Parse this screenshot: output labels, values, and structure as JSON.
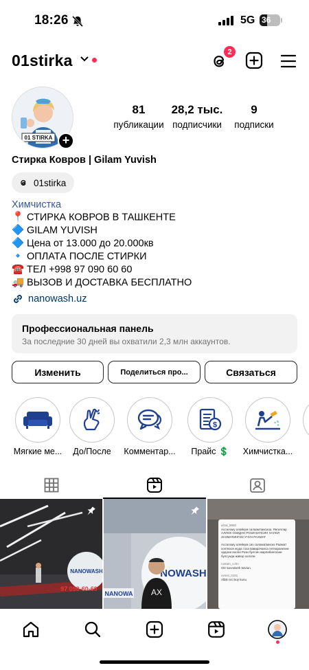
{
  "status_bar": {
    "time": "18:26",
    "network": "5G",
    "battery": "36",
    "battery_level": 0.36
  },
  "header": {
    "username": "01stirka",
    "notification_count": "2",
    "icons": [
      "threads-icon",
      "new-post-icon",
      "menu-icon"
    ]
  },
  "profile": {
    "stats": [
      {
        "value": "81",
        "label": "публикации"
      },
      {
        "value": "28,2 тыс.",
        "label": "подписчики"
      },
      {
        "value": "9",
        "label": "подписки"
      }
    ],
    "display_name": "Стирка Ковров | Gilam Yuvish",
    "threads_handle": "01stirka",
    "category": "Химчистка",
    "bio": [
      {
        "icon": "📍",
        "text": "СТИРКА КОВРОВ В ТАШКЕНТЕ"
      },
      {
        "icon": "🔷",
        "text": "GILAM YUVISH"
      },
      {
        "icon": "🔷",
        "text": "Цена от 13.000 до 20.000кв"
      },
      {
        "icon": "🔹",
        "text": "ОПЛАТА ПОСЛЕ СТИРКИ"
      },
      {
        "icon": "☎️",
        "text": "ТЕЛ +998 97 090 60 60"
      },
      {
        "icon": "🚚",
        "text": "ВЫЗОВ И ДОСТАВКА БЕСПЛАТНО"
      }
    ],
    "link": "nanowash.uz",
    "avatar_text": "01 STIRKA"
  },
  "pro_panel": {
    "title": "Профессиональная панель",
    "subtitle": "За последние 30 дней вы охватили 2,3 млн аккаунтов."
  },
  "actions": {
    "edit": "Изменить",
    "share": "Поделиться про...",
    "contact": "Связаться"
  },
  "highlights": [
    {
      "label": "Мягкие ме...",
      "icon": "sofa-icon"
    },
    {
      "label": "До/После",
      "icon": "fingers-crossed-icon"
    },
    {
      "label": "Комментар...",
      "icon": "comments-icon"
    },
    {
      "label": "Прайс 💲",
      "icon": "price-list-icon"
    },
    {
      "label": "Химчистка...",
      "icon": "carpet-cleaning-icon"
    }
  ],
  "tabs": [
    "grid-icon",
    "reels-icon",
    "tagged-icon"
  ],
  "posts": [
    {
      "text_logo": "NANOWASH",
      "text_phone": "97 090-60-60"
    },
    {
      "text_logo": "NOWASH",
      "text_sub": "NANOWA"
    },
    {
      "comments": [
        {
          "user": "afzal_9990",
          "text": "Ассалому алайкум салаамтмисиза. Янгиллар АЛЛОХ ОЗИДАН РОЗИ БУЛСИН ХАЛОЛ ЗАХМАТИНГИЗ УЧУН РАХМАТ"
        },
        {
          "user": "",
          "text": "Ассалому алейкум сиз саламатмисиз Раамат хоптвоон жуда тоза ваварачанса геппаранизни ордони аоопи Рози булсин жарпабингизни булсунда жавор холопи"
        },
        {
          "user": "rustam_cchn",
          "text": "Ok! 5ovrabeth 5aviun."
        },
        {
          "user": "uvosti_0181",
          "text": "Albik nici kuy kunu"
        }
      ]
    }
  ],
  "bottom_nav": [
    "home-icon",
    "search-icon",
    "create-icon",
    "reels-icon",
    "profile-avatar"
  ]
}
